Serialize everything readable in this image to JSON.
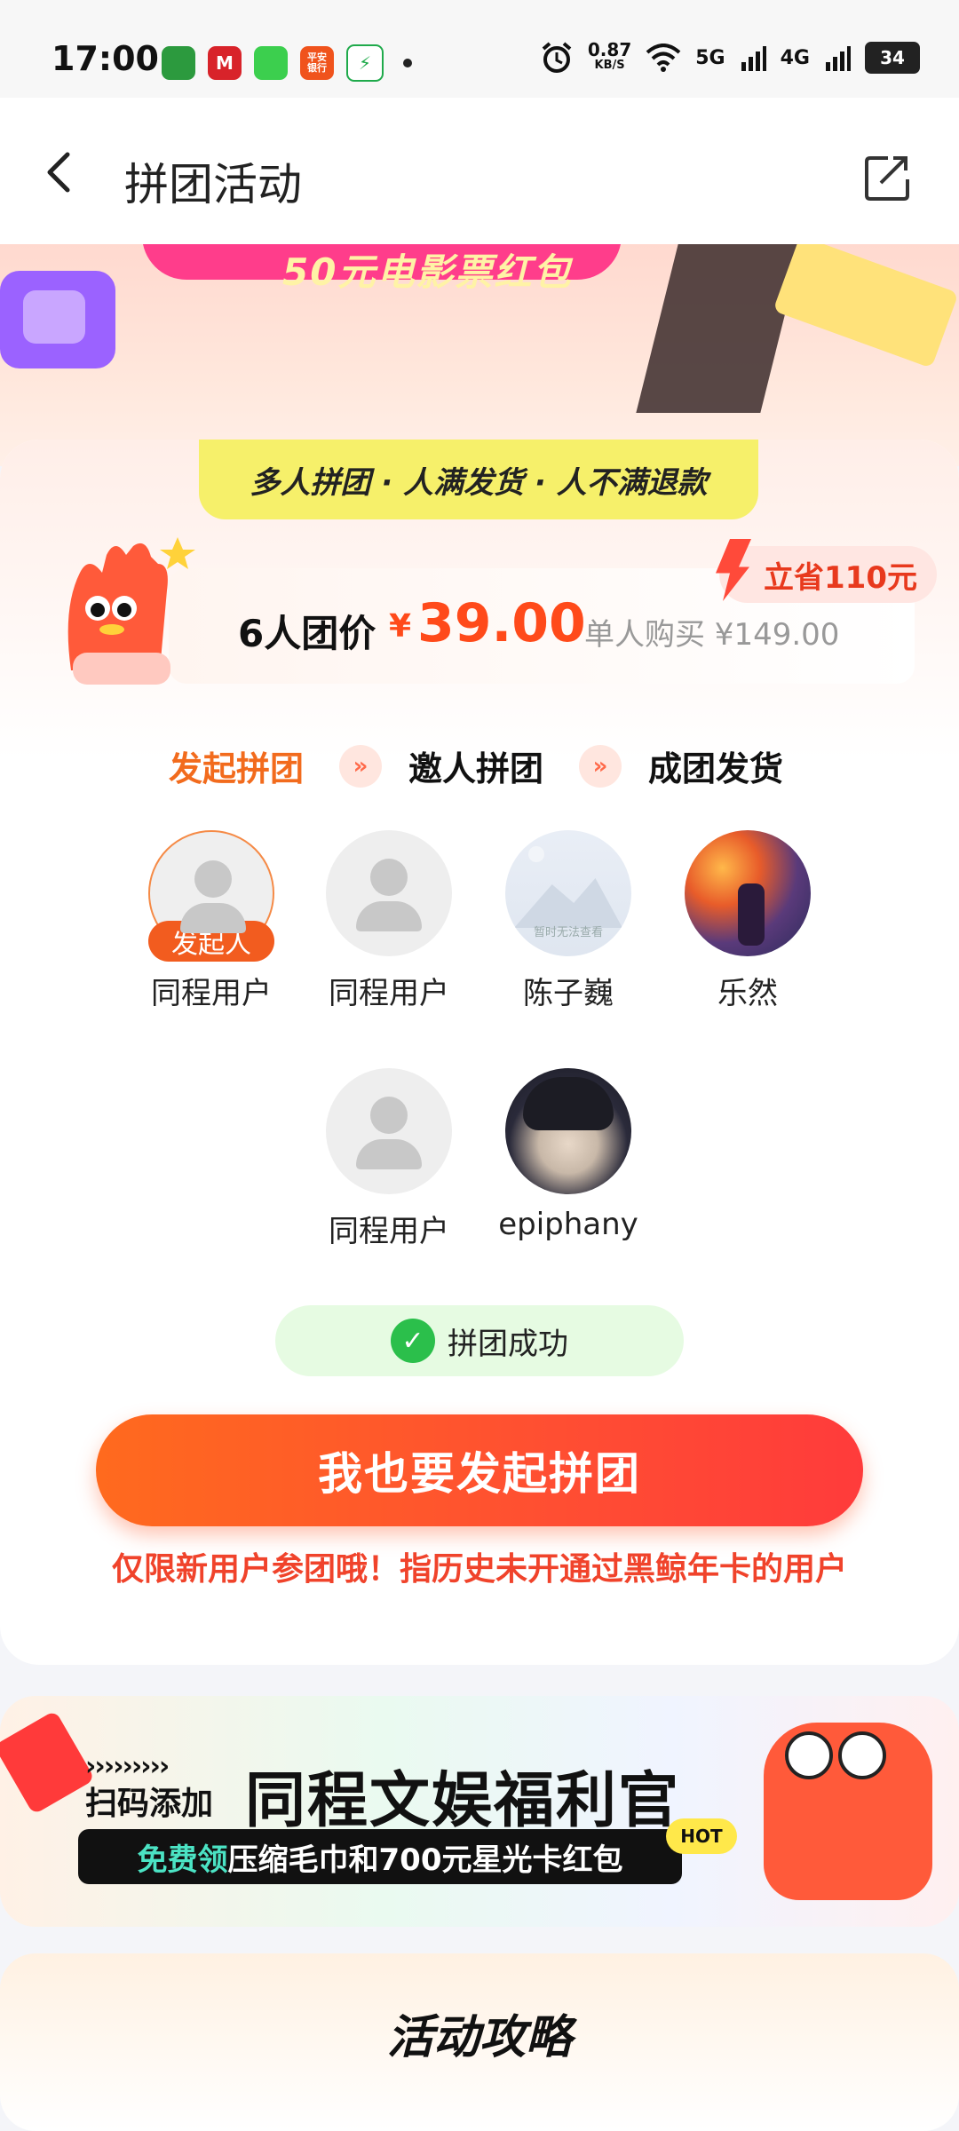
{
  "status_bar": {
    "time": "17:00",
    "app_icons": [
      {
        "name": "calendar-app-icon",
        "label": "",
        "color": "#2c9a3e"
      },
      {
        "name": "metro-app-icon",
        "label": "M",
        "color": "#d8232a"
      },
      {
        "name": "messages-app-icon",
        "label": "",
        "color": "#3ccf4e"
      },
      {
        "name": "pingan-bank-icon",
        "label": "平安\n银行",
        "color": "#f0531c"
      },
      {
        "name": "security-app-icon",
        "label": "⚡",
        "color": "#1faa4b"
      }
    ],
    "net_speed": "0.87",
    "net_unit": "KB/S",
    "signal1": "5G",
    "signal2": "4G",
    "battery": "34"
  },
  "nav": {
    "title": "拼团活动"
  },
  "hero": {
    "banner_text": "50元电影票红包"
  },
  "card": {
    "tagline": "多人拼团 · 人满发货 · 人不满退款",
    "group_price_label": "6人团价",
    "currency": "¥",
    "group_price": "39.00",
    "single_price": "单人购买 ¥149.00",
    "save_badge": "立省110元",
    "steps": [
      "发起拼团",
      "邀人拼团",
      "成团发货"
    ],
    "members": [
      {
        "name": "同程用户",
        "avatar": "initiator",
        "tag": "发起人"
      },
      {
        "name": "同程用户",
        "avatar": "default"
      },
      {
        "name": "陈子巍",
        "avatar": "placeholder",
        "placeholder_text": "暂时无法查看"
      },
      {
        "name": "乐然",
        "avatar": "painting"
      },
      {
        "name": "同程用户",
        "avatar": "default"
      },
      {
        "name": "epiphany",
        "avatar": "anime"
      }
    ],
    "status": "拼团成功",
    "cta": "我也要发起拼团",
    "notice": "仅限新用户参团哦！指历史未开通过黑鲸年卡的用户"
  },
  "promo": {
    "arrows": "›››››››››",
    "small_text": "扫码添加",
    "big_text": "同程文娱福利官",
    "bar_highlight": "免费领",
    "bar_text": "压缩毛巾和700元星光卡红包",
    "hot": "HOT"
  },
  "strategy": {
    "title": "活动攻略"
  }
}
